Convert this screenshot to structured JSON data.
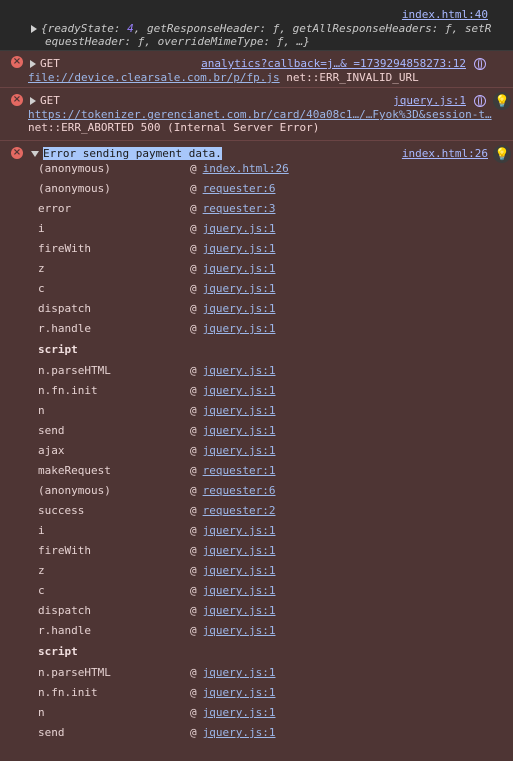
{
  "entries": [
    {
      "type": "plain",
      "source": "index.html:40",
      "object_line1_pre": "{readyState: ",
      "object_line1_num": "4",
      "object_line1_post": ", getResponseHeader: ƒ, getAllResponseHeaders: ƒ, setR",
      "object_line2": "equestHeader: ƒ, overrideMimeType: ƒ, …}"
    },
    {
      "type": "error",
      "method": "GET",
      "source": "analytics?callback=j…& =1739294858273:12",
      "url": "file://device.clearsale.com.br/p/fp.js",
      "message": " net::ERR_INVALID_URL"
    },
    {
      "type": "error",
      "method": "GET",
      "source": "jquery.js:1",
      "url": "https://tokenizer.gerencianet.com.br/card/40a08c1…/…Fyok%3D&session-t…",
      "message": "net::ERR_ABORTED 500 (Internal Server Error)"
    },
    {
      "type": "error",
      "message": "Error sending payment data.",
      "source": "index.html:26"
    }
  ],
  "stack": [
    {
      "fn": "(anonymous)",
      "loc": "index.html:26"
    },
    {
      "fn": "(anonymous)",
      "loc": "requester:6"
    },
    {
      "fn": "error",
      "loc": "requester:3"
    },
    {
      "fn": "i",
      "loc": "jquery.js:1"
    },
    {
      "fn": "fireWith",
      "loc": "jquery.js:1"
    },
    {
      "fn": "z",
      "loc": "jquery.js:1"
    },
    {
      "fn": "c",
      "loc": "jquery.js:1"
    },
    {
      "fn": "dispatch",
      "loc": "jquery.js:1"
    },
    {
      "fn": "r.handle",
      "loc": "jquery.js:1"
    },
    {
      "section": "script"
    },
    {
      "fn": "n.parseHTML",
      "loc": "jquery.js:1"
    },
    {
      "fn": "n.fn.init",
      "loc": "jquery.js:1"
    },
    {
      "fn": "n",
      "loc": "jquery.js:1"
    },
    {
      "fn": "send",
      "loc": "jquery.js:1"
    },
    {
      "fn": "ajax",
      "loc": "jquery.js:1"
    },
    {
      "fn": "makeRequest",
      "loc": "requester:1"
    },
    {
      "fn": "(anonymous)",
      "loc": "requester:6"
    },
    {
      "fn": "success",
      "loc": "requester:2"
    },
    {
      "fn": "i",
      "loc": "jquery.js:1"
    },
    {
      "fn": "fireWith",
      "loc": "jquery.js:1"
    },
    {
      "fn": "z",
      "loc": "jquery.js:1"
    },
    {
      "fn": "c",
      "loc": "jquery.js:1"
    },
    {
      "fn": "dispatch",
      "loc": "jquery.js:1"
    },
    {
      "fn": "r.handle",
      "loc": "jquery.js:1"
    },
    {
      "section": "script"
    },
    {
      "fn": "n.parseHTML",
      "loc": "jquery.js:1"
    },
    {
      "fn": "n.fn.init",
      "loc": "jquery.js:1"
    },
    {
      "fn": "n",
      "loc": "jquery.js:1"
    },
    {
      "fn": "send",
      "loc": "jquery.js:1"
    }
  ],
  "at_symbol": "@",
  "icons": {
    "error": "error-circle-icon",
    "network": "network-globe-icon",
    "insights": "lightbulb-insights-icon"
  },
  "colors": {
    "error_bg": "#4e3534",
    "error_icon": "#e46962",
    "link": "#9cb6e8",
    "selection": "#a8c7fa"
  }
}
